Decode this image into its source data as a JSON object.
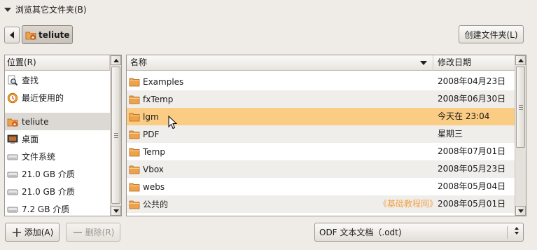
{
  "expander": {
    "label": "浏览其它文件夹(B)"
  },
  "path_bar": {
    "current": "teliute"
  },
  "toolbar": {
    "create_folder": "创建文件夹(L)"
  },
  "places": {
    "header": "位置(R)",
    "items": [
      {
        "label": "查找",
        "icon": "search-icon"
      },
      {
        "label": "最近使用的",
        "icon": "recent-icon"
      },
      {
        "label": "teliute",
        "icon": "home-folder-icon",
        "selected": true
      },
      {
        "label": "桌面",
        "icon": "desktop-icon"
      },
      {
        "label": "文件系统",
        "icon": "drive-icon"
      },
      {
        "label": "21.0 GB 介质",
        "icon": "drive-icon"
      },
      {
        "label": "21.0 GB 介质",
        "icon": "drive-icon"
      },
      {
        "label": "7.2 GB 介质",
        "icon": "drive-icon"
      }
    ]
  },
  "files": {
    "columns": {
      "name": "名称",
      "modified": "修改日期"
    },
    "rows": [
      {
        "name": "Examples",
        "date": "2008年04月23日"
      },
      {
        "name": "fxTemp",
        "date": "2008年06月30日"
      },
      {
        "name": "lgm",
        "date": "今天在  23:04",
        "selected": true
      },
      {
        "name": "PDF",
        "date": "星期三"
      },
      {
        "name": "Temp",
        "date": "2008年07月01日"
      },
      {
        "name": "Vbox",
        "date": "2008年05月23日"
      },
      {
        "name": "webs",
        "date": "2008年05月04日"
      },
      {
        "name": "公共的",
        "date": "2008年05月01日"
      }
    ],
    "watermark": "《基础教程网》"
  },
  "bottom": {
    "add": "添加(A)",
    "remove": "删除(R)",
    "filter_value": "ODF 文本文档（.odt)"
  },
  "colors": {
    "background": "#efebe7",
    "selection_row": "#fbcc83",
    "folder_orange": "#f0a24a"
  }
}
